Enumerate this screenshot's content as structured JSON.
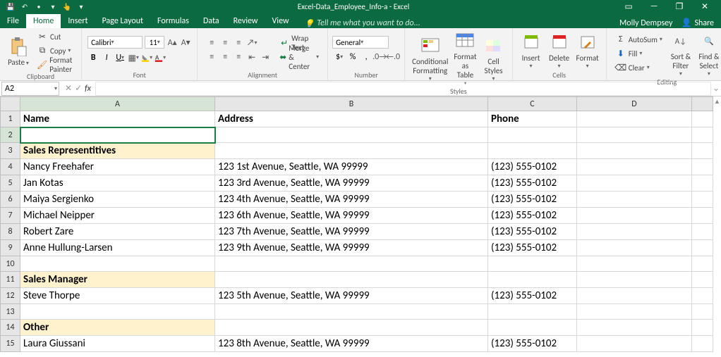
{
  "window": {
    "title": "Excel-Data_Employee_Info-a - Excel",
    "user": "Molly Dempsey",
    "share": "Share"
  },
  "tabs": {
    "file": "File",
    "home": "Home",
    "insert": "Insert",
    "pagelayout": "Page Layout",
    "formulas": "Formulas",
    "data": "Data",
    "review": "Review",
    "view": "View",
    "tellme": "Tell me what you want to do..."
  },
  "ribbon": {
    "clipboard": {
      "title": "Clipboard",
      "paste": "Paste",
      "cut": "Cut",
      "copy": "Copy",
      "fp": "Format Painter"
    },
    "font": {
      "title": "Font",
      "name": "Calibri",
      "size": "11",
      "bold": "B",
      "italic": "I",
      "underline": "U"
    },
    "alignment": {
      "title": "Alignment",
      "wrap": "Wrap Text",
      "merge": "Merge & Center"
    },
    "number": {
      "title": "Number",
      "format": "General",
      "dollar": "$",
      "percent": "%",
      "comma": ","
    },
    "styles": {
      "title": "Styles",
      "cf": "Conditional Formatting",
      "ft": "Format as Table",
      "cs": "Cell Styles"
    },
    "cells": {
      "title": "Cells",
      "ins": "Insert",
      "del": "Delete",
      "fmt": "Format"
    },
    "editing": {
      "title": "Editing",
      "sum": "AutoSum",
      "fill": "Fill",
      "clear": "Clear",
      "sort": "Sort & Filter",
      "find": "Find & Select"
    }
  },
  "namebox": "A2",
  "columns": [
    "",
    "A",
    "B",
    "C",
    "D",
    ""
  ],
  "rows": [
    {
      "r": "1",
      "A": "Name",
      "B": "Address",
      "C": "Phone",
      "bold": true
    },
    {
      "r": "2",
      "A": "",
      "B": "",
      "C": "",
      "sel": true
    },
    {
      "r": "3",
      "A": "Sales Representitives",
      "B": "",
      "C": "",
      "band": true,
      "bold": true
    },
    {
      "r": "4",
      "A": "Nancy Freehafer",
      "B": "123 1st Avenue, Seattle, WA 99999",
      "C": "(123) 555-0102"
    },
    {
      "r": "5",
      "A": "Jan Kotas",
      "B": "123 3rd Avenue, Seattle, WA 99999",
      "C": "(123) 555-0102"
    },
    {
      "r": "6",
      "A": "Maiya Sergienko",
      "B": "123 4th Avenue, Seattle, WA 99999",
      "C": "(123) 555-0102"
    },
    {
      "r": "7",
      "A": "Michael Neipper",
      "B": "123 6th Avenue, Seattle, WA 99999",
      "C": "(123) 555-0102"
    },
    {
      "r": "8",
      "A": "Robert Zare",
      "B": "123 7th Avenue, Seattle, WA 99999",
      "C": "(123) 555-0102"
    },
    {
      "r": "9",
      "A": "Anne Hullung-Larsen",
      "B": "123 9th Avenue, Seattle, WA 99999",
      "C": "(123) 555-0102"
    },
    {
      "r": "10",
      "A": "",
      "B": "",
      "C": ""
    },
    {
      "r": "11",
      "A": "Sales Manager",
      "B": "",
      "C": "",
      "band": true,
      "bold": true
    },
    {
      "r": "12",
      "A": "Steve Thorpe",
      "B": "123 5th Avenue, Seattle, WA 99999",
      "C": "(123) 555-0102"
    },
    {
      "r": "13",
      "A": "",
      "B": "",
      "C": ""
    },
    {
      "r": "14",
      "A": "Other",
      "B": "",
      "C": "",
      "band": true,
      "bold": true
    },
    {
      "r": "15",
      "A": "Laura Giussani",
      "B": "123 8th Avenue, Seattle, WA 99999",
      "C": "(123) 555-0102"
    }
  ]
}
